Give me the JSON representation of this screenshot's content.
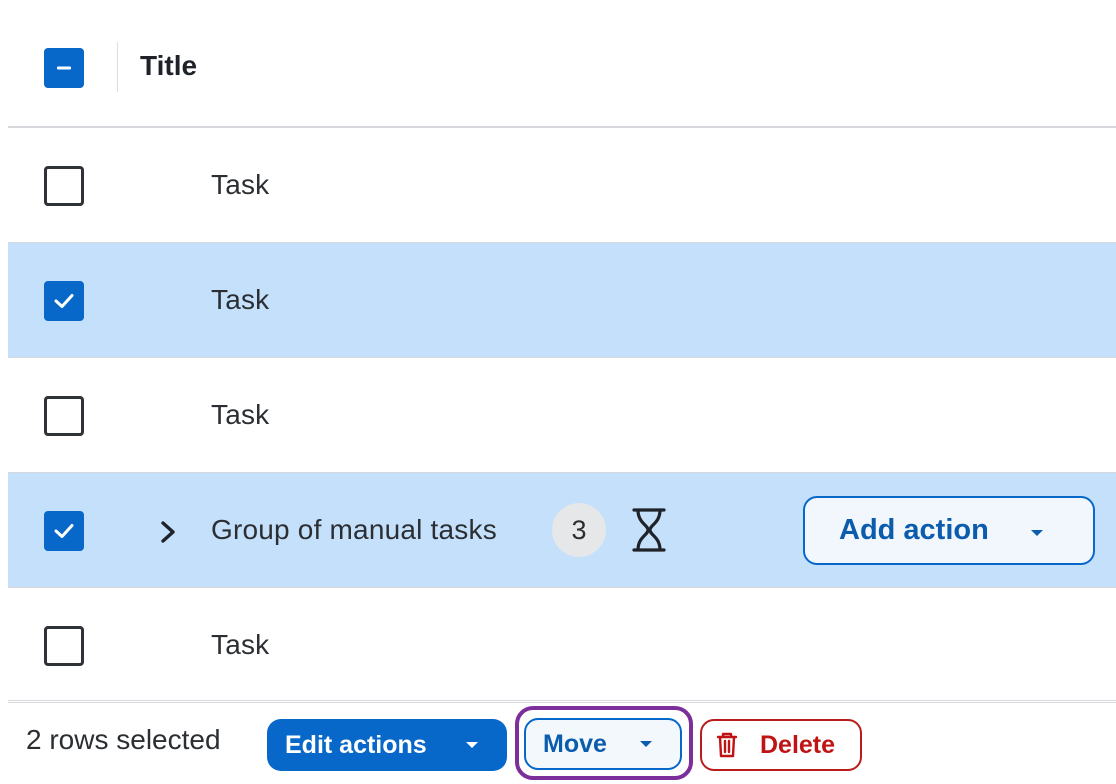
{
  "header": {
    "title": "Title"
  },
  "rows": [
    {
      "title": "Task",
      "selected": false
    },
    {
      "title": "Task",
      "selected": true
    },
    {
      "title": "Task",
      "selected": false
    },
    {
      "title": "Group of manual tasks",
      "selected": true,
      "count": "3",
      "action_label": "Add action"
    },
    {
      "title": "Task",
      "selected": false
    }
  ],
  "footer": {
    "selected_text": "2 rows selected",
    "edit_actions_label": "Edit actions",
    "move_label": "Move",
    "delete_label": "Delete"
  },
  "colors": {
    "accent": "#0868c9",
    "selected_row": "#c4e0fa",
    "danger": "#c01414",
    "focus_ring": "#7c2e9a"
  },
  "icons": [
    "indeterminate-checkbox-icon",
    "checkmark-icon",
    "chevron-right-icon",
    "hourglass-icon",
    "caret-down-icon",
    "trash-icon"
  ]
}
